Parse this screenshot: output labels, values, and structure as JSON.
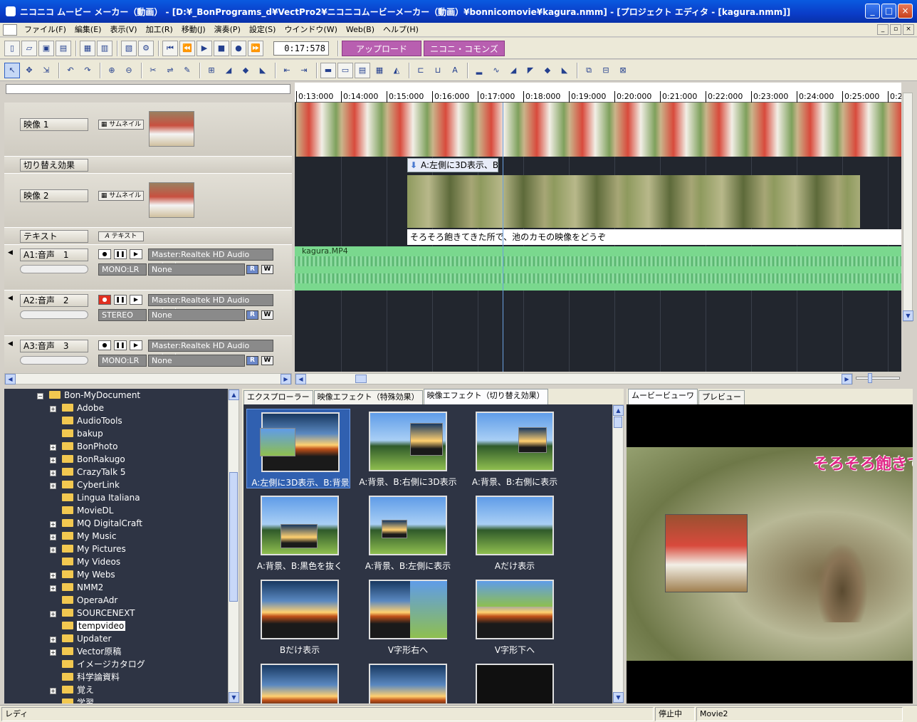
{
  "window": {
    "title": "ニコニコ ムービー メーカー（動画） - [D:¥_BonPrograms_d¥VectPro2¥ニコニコムービーメーカー（動画）¥bonnicomovie¥kagura.nmm] - [プロジェクト エディタ - [kagura.nmm]]"
  },
  "menu": [
    "ファイル(F)",
    "編集(E)",
    "表示(V)",
    "加工(R)",
    "移動(J)",
    "演奏(P)",
    "設定(S)",
    "ウインドウ(W)",
    "Web(B)",
    "ヘルプ(H)"
  ],
  "toolbar": {
    "timecode": "0:17:578",
    "upload_label": "アップロード",
    "commons_label": "ニコニ・コモンズ"
  },
  "ruler": [
    "0:13:000",
    "0:14:000",
    "0:15:000",
    "0:16:000",
    "0:17:000",
    "0:18:000",
    "0:19:000",
    "0:20:000",
    "0:21:000",
    "0:22:000",
    "0:23:000",
    "0:24:000",
    "0:25:000",
    "0:2"
  ],
  "tracks": {
    "video1": "映像 1",
    "transition": "切り替え効果",
    "video2": "映像 2",
    "text": "テキスト",
    "thumbnail_btn": "サムネイル",
    "text_btn": "テキスト",
    "audio": [
      {
        "name": "A1:音声　1",
        "output": "Master:Realtek HD Audio output",
        "mode": "MONO:LR",
        "effect": "None"
      },
      {
        "name": "A2:音声　2",
        "output": "Master:Realtek HD Audio output",
        "mode": "STEREO",
        "effect": "None"
      },
      {
        "name": "A3:音声　3",
        "output": "Master:Realtek HD Audio output",
        "mode": "MONO:LR",
        "effect": "None"
      }
    ],
    "r_label": "R",
    "w_label": "W"
  },
  "timeline": {
    "transition_label": "A:左側に3D表示、B:",
    "caption": "そろそろ飽きてきた所で、池のカモの映像をどうぞ",
    "audio_clip": "kagura.MP4"
  },
  "tree": {
    "root": "Bon-MyDocument",
    "items": [
      {
        "label": "Adobe",
        "plus": true
      },
      {
        "label": "AudioTools",
        "plus": false
      },
      {
        "label": "bakup",
        "plus": false
      },
      {
        "label": "BonPhoto",
        "plus": true
      },
      {
        "label": "BonRakugo",
        "plus": true
      },
      {
        "label": "CrazyTalk 5",
        "plus": true
      },
      {
        "label": "CyberLink",
        "plus": true
      },
      {
        "label": "Lingua Italiana",
        "plus": false
      },
      {
        "label": "MovieDL",
        "plus": false
      },
      {
        "label": "MQ DigitalCraft",
        "plus": true
      },
      {
        "label": "My Music",
        "plus": true
      },
      {
        "label": "My Pictures",
        "plus": true
      },
      {
        "label": "My Videos",
        "plus": false
      },
      {
        "label": "My Webs",
        "plus": true
      },
      {
        "label": "NMM2",
        "plus": true
      },
      {
        "label": "OperaAdr",
        "plus": false
      },
      {
        "label": "SOURCENEXT",
        "plus": true
      },
      {
        "label": "tempvideo",
        "plus": false
      },
      {
        "label": "Updater",
        "plus": true
      },
      {
        "label": "Vector原稿",
        "plus": true
      },
      {
        "label": "イメージカタログ",
        "plus": false
      },
      {
        "label": "科学論資料",
        "plus": false
      },
      {
        "label": "覚え",
        "plus": true
      },
      {
        "label": "学習",
        "plus": false
      }
    ],
    "selected": "tempvideo"
  },
  "effects_tabs": [
    "エクスプローラー",
    "映像エフェクト（特殊効果）",
    "映像エフェクト（切り替え効果）"
  ],
  "effects": [
    "A:左側に3D表示、B:背景",
    "A:背景、B:右側に3D表示",
    "A:背景、B:右側に表示",
    "A:背景、B:黒色を抜く",
    "A:背景、B:左側に表示",
    "Aだけ表示",
    "Bだけ表示",
    "V字形右へ",
    "V字形下へ"
  ],
  "viewer": {
    "tabs": [
      "ムービービューワ",
      "プレビュー"
    ],
    "overlay_text": "そろそろ飽きて"
  },
  "status": {
    "left": "レディ",
    "state": "停止中",
    "name": "Movie2"
  }
}
